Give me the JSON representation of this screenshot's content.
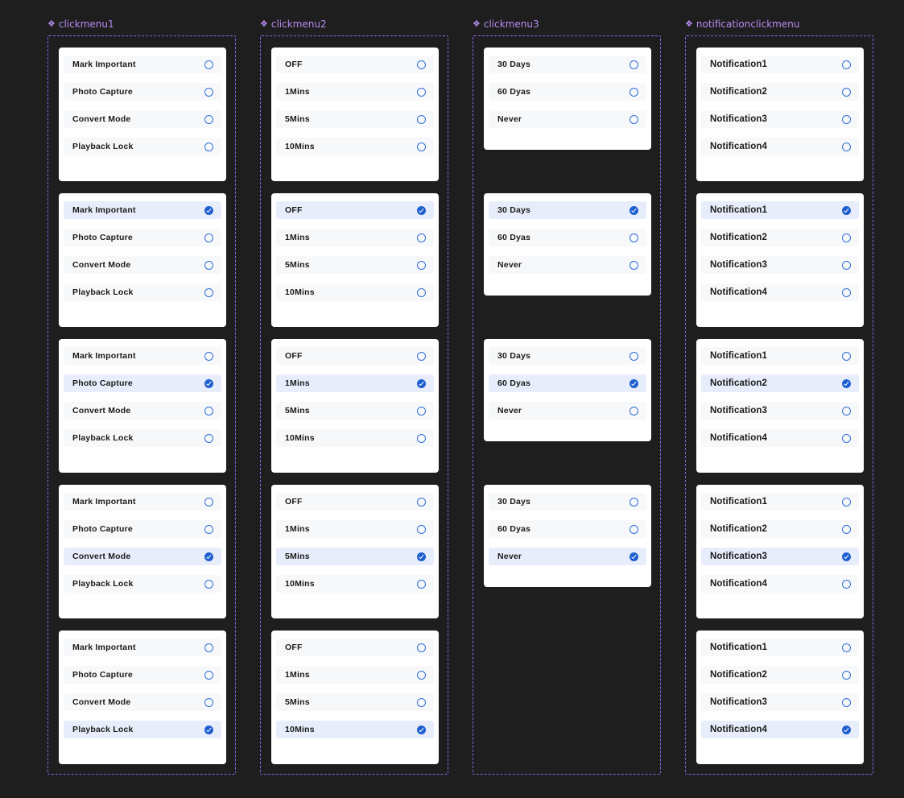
{
  "components": [
    {
      "name": "clickmenu1",
      "icon": "component-diamond-icon",
      "options": [
        "Mark Important",
        "Photo Capture",
        "Convert Mode",
        "Playback Lock"
      ],
      "variants": [
        {
          "selected": null
        },
        {
          "selected": 0
        },
        {
          "selected": 1
        },
        {
          "selected": 2
        },
        {
          "selected": 3
        }
      ]
    },
    {
      "name": "clickmenu2",
      "icon": "component-diamond-icon",
      "options": [
        "OFF",
        "1Mins",
        "5Mins",
        "10Mins"
      ],
      "variants": [
        {
          "selected": null
        },
        {
          "selected": 0
        },
        {
          "selected": 1
        },
        {
          "selected": 2
        },
        {
          "selected": 3
        }
      ]
    },
    {
      "name": "clickmenu3",
      "icon": "component-diamond-icon",
      "options": [
        "30 Days",
        "60 Dyas",
        "Never"
      ],
      "variants": [
        {
          "selected": null
        },
        {
          "selected": 0
        },
        {
          "selected": 1
        },
        {
          "selected": 2
        }
      ]
    },
    {
      "name": "notificationclickmenu",
      "icon": "component-diamond-icon",
      "options": [
        "Notification1",
        "Notification2",
        "Notification3",
        "Notification4"
      ],
      "variants": [
        {
          "selected": null
        },
        {
          "selected": 0
        },
        {
          "selected": 1
        },
        {
          "selected": 2
        },
        {
          "selected": 3
        }
      ]
    }
  ],
  "colors": {
    "canvas": "#1e1e1e",
    "component_label": "#b48cf2",
    "frame_border": "#8f63e8",
    "card": "#ffffff",
    "item_bg": "#f7f8fa",
    "item_selected_bg": "#e8edfb",
    "radio": "#1f5fcf"
  }
}
